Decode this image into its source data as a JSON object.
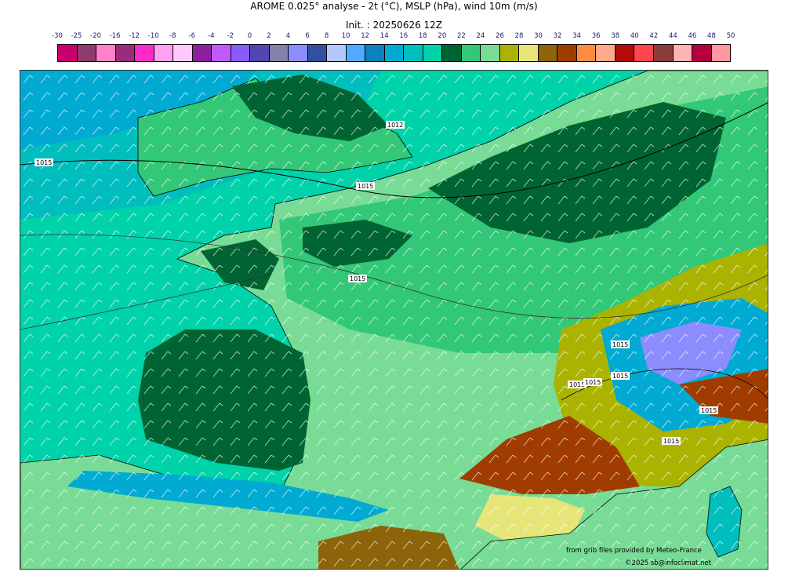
{
  "header": {
    "title": "AROME 0.025° analyse - 2t (°C), MSLP (hPa), wind 10m (m/s)",
    "init": "Init. : 20250626 12Z"
  },
  "colorbar": {
    "ticks": [
      "-30",
      "-25",
      "-20",
      "-16",
      "-12",
      "-10",
      "-8",
      "-6",
      "-4",
      "-2",
      "0",
      "2",
      "4",
      "6",
      "8",
      "10",
      "12",
      "14",
      "16",
      "18",
      "20",
      "22",
      "24",
      "26",
      "28",
      "30",
      "32",
      "34",
      "36",
      "38",
      "40",
      "42",
      "44",
      "46",
      "48",
      "50"
    ],
    "colors": [
      "#c8006e",
      "#8b3c6c",
      "#ff82c8",
      "#9b2b7c",
      "#ff28c8",
      "#ffa0f0",
      "#ffc8ff",
      "#8c1ea0",
      "#be5aff",
      "#8c5aff",
      "#5046b4",
      "#8282aa",
      "#8c8cff",
      "#3250a0",
      "#b4c8ff",
      "#50aaff",
      "#0a82be",
      "#00aad2",
      "#00bebe",
      "#00d2aa",
      "#006432",
      "#32c878",
      "#78dc96",
      "#aab400",
      "#e6e678",
      "#8c640a",
      "#a03c00",
      "#ff8c3c",
      "#ffaa8c",
      "#b40a0a",
      "#ff4650",
      "#8c3c3c",
      "#ffb4b4",
      "#b4003c",
      "#ff96a0"
    ]
  },
  "map": {
    "isobar_labels": [
      "1015",
      "1015",
      "1015",
      "1012",
      "1015",
      "1015",
      "1015",
      "1015",
      "1015",
      "1015"
    ],
    "palette": {
      "sea": "#00d2aa",
      "sea_cool": "#00bebe",
      "channel": "#00aad2",
      "land_mild": "#32c878",
      "land_warm": "#78dc96",
      "cool_patch": "#006432",
      "hot_olive": "#aab400",
      "hot_yellow": "#e6e678",
      "hot_brown": "#8c640a",
      "hot_rust": "#a03c00",
      "alps_blue": "#50aaff",
      "alps_violet": "#8c8cff",
      "med_sea": "#78dc96"
    }
  },
  "credits": {
    "provider": "from grib files provided by Meteo-France",
    "copyright": "©2025 sb@infoclimat.net"
  }
}
